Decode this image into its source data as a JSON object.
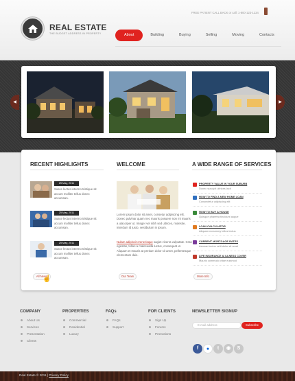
{
  "header": {
    "logo_title": "REAL ESTATE",
    "logo_tagline": "THE BUDGET ADDRESS IN PROPERTY",
    "call_text": "FREE PATIENT CALL BACK or call: 1-800-123-1234"
  },
  "nav": {
    "items": [
      "About",
      "Building",
      "Buying",
      "Selling",
      "Moving",
      "Contacts"
    ],
    "active": "About"
  },
  "highlights": {
    "title": "RECENT HIGHLIGHTS",
    "items": [
      {
        "date": "25 May, 2011",
        "text": "Susce lectus intermo tristique sit accum molliter tellus donec accumsan."
      },
      {
        "date": "25 May, 2011",
        "text": "Susce lectus intermo tristique sit accum molliter tellus donec accumsan."
      },
      {
        "date": "25 May, 2011",
        "text": "Susce lectus intermo tristique sit accum molliter tellus donec accumsan."
      }
    ],
    "button": "All News"
  },
  "welcome": {
    "title": "WELCOME",
    "para1": "Lorem ipsum dolor sit amet, consetur adipiscing elit. Donec pulvinar quam nec mauris posuere non mi mauris a ulacorper ut. Integer vel nibh sed ultrices, molestie, interdum id justo, vestibulum in ipsum.",
    "link": "Nulam adipiscit crenerisque",
    "para2": "sagiet viverra vulputate. Cras egestas, tellus a malesuada luctus, consequat ut. Aliquam et mauris at pretium dolor sit amet, pellentesque elementum duis.",
    "button": "Our Team"
  },
  "services": {
    "title": "A WIDE RANGE OF SERVICES",
    "items": [
      {
        "title": "PROPERTY VALUE IN YOUR SUBURB",
        "desc": "Donec suscipit ultrices lacit"
      },
      {
        "title": "HOW TO FIND A NEW HOME LOAN",
        "desc": "Consectetur adipiscing elit"
      },
      {
        "title": "HOW TO BUY A HOUSE",
        "desc": "Quisque pharetra tincidunt augue"
      },
      {
        "title": "LOAN CALCULATOR",
        "desc": "Aliquam nonummy tellus lectus"
      },
      {
        "title": "CURRENT MORTGAGE RATES",
        "desc": "Aenean lectus velit dolor sit amet"
      },
      {
        "title": "LIFE INSURANCE & ILLNESS COVER",
        "desc": "Mauris commodo vitae euismod"
      }
    ],
    "button": "More Info",
    "icon_colors": [
      "#e0231f",
      "#2f6fbf",
      "#3a8a3a",
      "#e07a1f",
      "#7a3a9a",
      "#c0392b"
    ]
  },
  "footer": {
    "columns": [
      {
        "title": "COMPANY",
        "items": [
          "About Us",
          "Services",
          "Presentation",
          "Clients"
        ]
      },
      {
        "title": "PROPERTIES",
        "items": [
          "Commercial",
          "Residential",
          "Luxury"
        ]
      },
      {
        "title": "FAQs",
        "items": [
          "FAQs",
          "Support"
        ]
      },
      {
        "title": "FOR CLIENTS",
        "items": [
          "Sign Up",
          "Forums",
          "Promotions"
        ]
      }
    ],
    "newsletter": {
      "title": "NEWSLETTER SIGNUP",
      "placeholder": "E-mail address",
      "button": "Subscribe"
    },
    "social_icons": [
      "facebook-icon",
      "flickr-icon",
      "twitter-icon",
      "rss-icon",
      "skype-icon"
    ]
  },
  "bottom": {
    "copyright": "Real Estate © 2011 |",
    "privacy": "Privacy Policy"
  },
  "colors": {
    "accent": "#e0231f",
    "dark": "#3a3a3a"
  }
}
